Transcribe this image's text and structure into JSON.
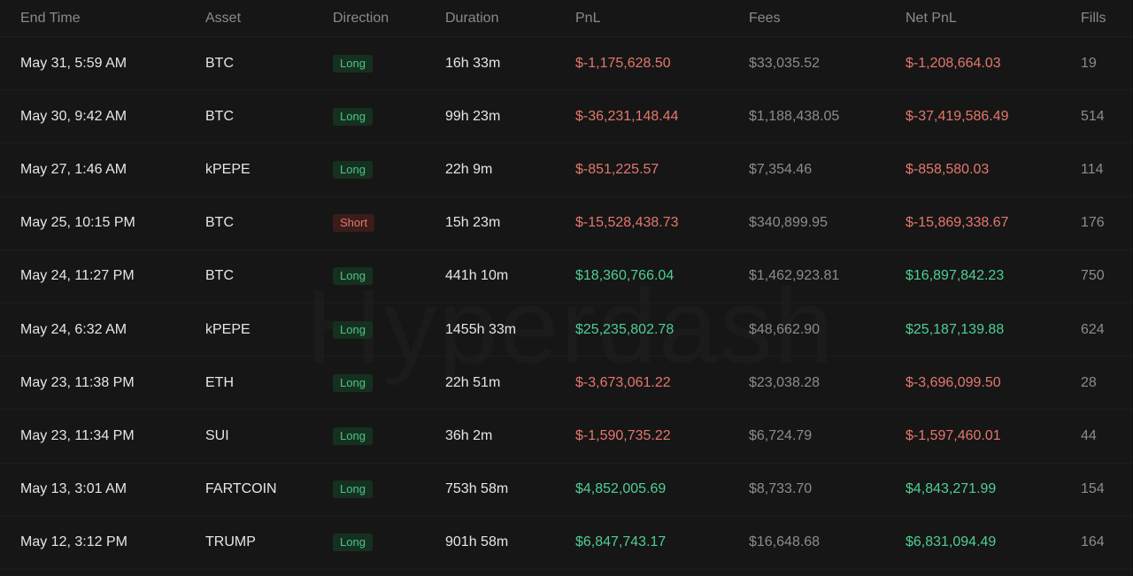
{
  "watermark": "Hyperdash",
  "columns": {
    "end_time": "End Time",
    "asset": "Asset",
    "direction": "Direction",
    "duration": "Duration",
    "pnl": "PnL",
    "fees": "Fees",
    "net_pnl": "Net PnL",
    "fills": "Fills"
  },
  "colors": {
    "positive": "#4fcf92",
    "negative": "#e5776b",
    "background": "#161616"
  },
  "rows": [
    {
      "end_time": "May 31, 5:59 AM",
      "asset": "BTC",
      "direction": "Long",
      "duration": "16h 33m",
      "pnl": "$-1,175,628.50",
      "fees": "$33,035.52",
      "net_pnl": "$-1,208,664.03",
      "fills": "19"
    },
    {
      "end_time": "May 30, 9:42 AM",
      "asset": "BTC",
      "direction": "Long",
      "duration": "99h 23m",
      "pnl": "$-36,231,148.44",
      "fees": "$1,188,438.05",
      "net_pnl": "$-37,419,586.49",
      "fills": "514"
    },
    {
      "end_time": "May 27, 1:46 AM",
      "asset": "kPEPE",
      "direction": "Long",
      "duration": "22h 9m",
      "pnl": "$-851,225.57",
      "fees": "$7,354.46",
      "net_pnl": "$-858,580.03",
      "fills": "114"
    },
    {
      "end_time": "May 25, 10:15 PM",
      "asset": "BTC",
      "direction": "Short",
      "duration": "15h 23m",
      "pnl": "$-15,528,438.73",
      "fees": "$340,899.95",
      "net_pnl": "$-15,869,338.67",
      "fills": "176"
    },
    {
      "end_time": "May 24, 11:27 PM",
      "asset": "BTC",
      "direction": "Long",
      "duration": "441h 10m",
      "pnl": "$18,360,766.04",
      "fees": "$1,462,923.81",
      "net_pnl": "$16,897,842.23",
      "fills": "750"
    },
    {
      "end_time": "May 24, 6:32 AM",
      "asset": "kPEPE",
      "direction": "Long",
      "duration": "1455h 33m",
      "pnl": "$25,235,802.78",
      "fees": "$48,662.90",
      "net_pnl": "$25,187,139.88",
      "fills": "624"
    },
    {
      "end_time": "May 23, 11:38 PM",
      "asset": "ETH",
      "direction": "Long",
      "duration": "22h 51m",
      "pnl": "$-3,673,061.22",
      "fees": "$23,038.28",
      "net_pnl": "$-3,696,099.50",
      "fills": "28"
    },
    {
      "end_time": "May 23, 11:34 PM",
      "asset": "SUI",
      "direction": "Long",
      "duration": "36h 2m",
      "pnl": "$-1,590,735.22",
      "fees": "$6,724.79",
      "net_pnl": "$-1,597,460.01",
      "fills": "44"
    },
    {
      "end_time": "May 13, 3:01 AM",
      "asset": "FARTCOIN",
      "direction": "Long",
      "duration": "753h 58m",
      "pnl": "$4,852,005.69",
      "fees": "$8,733.70",
      "net_pnl": "$4,843,271.99",
      "fills": "154"
    },
    {
      "end_time": "May 12, 3:12 PM",
      "asset": "TRUMP",
      "direction": "Long",
      "duration": "901h 58m",
      "pnl": "$6,847,743.17",
      "fees": "$16,648.68",
      "net_pnl": "$6,831,094.49",
      "fills": "164"
    }
  ]
}
